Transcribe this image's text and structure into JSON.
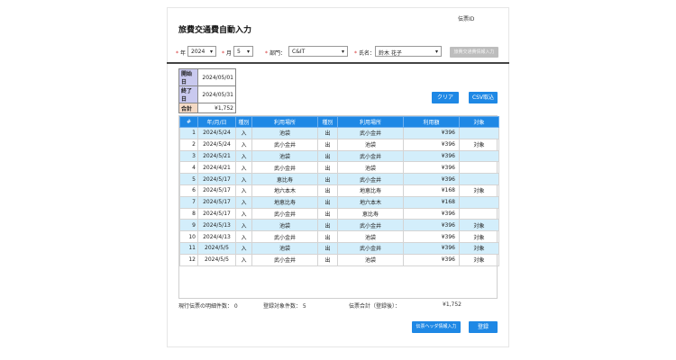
{
  "title": "旅費交通費自動入力",
  "voucher_id_label": "伝票ID",
  "filters": {
    "year_label": "年",
    "year_value": "2024",
    "month_label": "月",
    "month_value": "5",
    "dept_label": "部門：",
    "dept_value": "C&IT",
    "name_label": "氏名：",
    "name_value": "鈴木 花子",
    "fetch_button": "旅費交通費情報入力"
  },
  "summary": [
    {
      "label": "開始日",
      "value": "2024/05/01"
    },
    {
      "label": "終了日",
      "value": "2024/05/31"
    },
    {
      "label": "合計",
      "value": "¥1,752"
    }
  ],
  "buttons": {
    "clear": "クリア",
    "csv": "CSV取込",
    "header_input": "伝票ヘッダ情報入力",
    "register": "登録"
  },
  "table": {
    "headers": [
      "#",
      "年/月/日",
      "種別",
      "利用場所",
      "種別",
      "利用場所",
      "利用額",
      "対象"
    ],
    "rows": [
      [
        "1",
        "2024/5/24",
        "入",
        "池袋",
        "出",
        "武小金井",
        "¥396",
        ""
      ],
      [
        "2",
        "2024/5/24",
        "入",
        "武小金井",
        "出",
        "池袋",
        "¥396",
        "対象"
      ],
      [
        "3",
        "2024/5/21",
        "入",
        "池袋",
        "出",
        "武小金井",
        "¥396",
        ""
      ],
      [
        "4",
        "2024/4/21",
        "入",
        "武小金井",
        "出",
        "池袋",
        "¥396",
        ""
      ],
      [
        "5",
        "2024/5/17",
        "入",
        "恵比寿",
        "出",
        "武小金井",
        "¥396",
        ""
      ],
      [
        "6",
        "2024/5/17",
        "入",
        "地六本木",
        "出",
        "地恵比寿",
        "¥168",
        "対象"
      ],
      [
        "7",
        "2024/5/17",
        "入",
        "地恵比寿",
        "出",
        "地六本木",
        "¥168",
        ""
      ],
      [
        "8",
        "2024/5/17",
        "入",
        "武小金井",
        "出",
        "恵比寿",
        "¥396",
        ""
      ],
      [
        "9",
        "2024/5/13",
        "入",
        "池袋",
        "出",
        "武小金井",
        "¥396",
        "対象"
      ],
      [
        "10",
        "2024/4/13",
        "入",
        "武小金井",
        "出",
        "池袋",
        "¥396",
        "対象"
      ],
      [
        "11",
        "2024/5/5",
        "入",
        "池袋",
        "出",
        "武小金井",
        "¥396",
        "対象"
      ],
      [
        "12",
        "2024/5/5",
        "入",
        "武小金井",
        "出",
        "池袋",
        "¥396",
        "対象"
      ]
    ]
  },
  "footer": {
    "existing_count": "現行伝票の明細件数： 0",
    "target_count": "登録対象件数： 5",
    "total_label": "伝票合計（登録後）：",
    "total_value": "¥1,752"
  }
}
